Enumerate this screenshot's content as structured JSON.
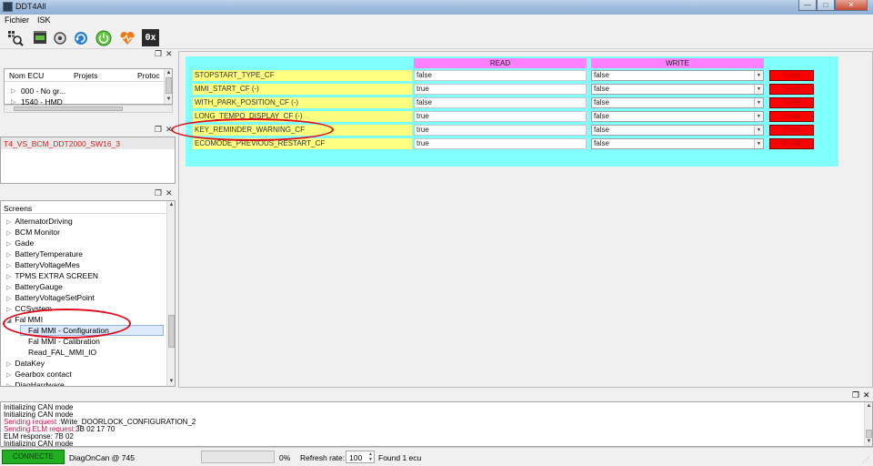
{
  "window": {
    "title": "DDT4All",
    "min_glyph": "—",
    "max_glyph": "□",
    "close_glyph": "✕"
  },
  "menu": {
    "items": [
      "Fichier",
      "ISK"
    ]
  },
  "toolbar": {
    "last_label": "0x"
  },
  "ecu_dock": {
    "columns": [
      "Nom ECU",
      "Projets",
      "Protoc"
    ],
    "rows": [
      "000 - No gr...",
      "1540 - HMD"
    ]
  },
  "project_dock": {
    "item": "T4_VS_BCM_DDT2000_SW16_3"
  },
  "screens_dock": {
    "header": "Screens",
    "items": [
      {
        "label": "AlternatorDriving",
        "arrow": "▷",
        "indent": 0
      },
      {
        "label": "BCM Monitor",
        "arrow": "▷",
        "indent": 0
      },
      {
        "label": "Gade",
        "arrow": "▷",
        "indent": 0
      },
      {
        "label": "BatteryTemperature",
        "arrow": "▷",
        "indent": 0
      },
      {
        "label": "BatteryVoltageMes",
        "arrow": "▷",
        "indent": 0
      },
      {
        "label": "TPMS EXTRA SCREEN",
        "arrow": "▷",
        "indent": 0
      },
      {
        "label": "BatteryGauge",
        "arrow": "▷",
        "indent": 0
      },
      {
        "label": "BatteryVoltageSetPoint",
        "arrow": "▷",
        "indent": 0
      },
      {
        "label": "CCSystem",
        "arrow": "▷",
        "indent": 0
      },
      {
        "label": "Fal MMI",
        "arrow": "◢",
        "indent": 0
      },
      {
        "label": "Fal MMI - Configuration",
        "arrow": "",
        "indent": 1,
        "selected": true
      },
      {
        "label": "Fal MMI - Calibration",
        "arrow": "",
        "indent": 1
      },
      {
        "label": "Read_FAL_MMI_IO",
        "arrow": "",
        "indent": 1
      },
      {
        "label": "DataKey",
        "arrow": "▷",
        "indent": 0
      },
      {
        "label": "Gearbox contact",
        "arrow": "▷",
        "indent": 0
      },
      {
        "label": "DiagHardware",
        "arrow": "▷",
        "indent": 0
      }
    ]
  },
  "config_panel": {
    "read_header": "READ",
    "write_header": "WRITE",
    "send_label": "Send",
    "rows": [
      {
        "name": "STOPSTART_TYPE_CF",
        "read": "false",
        "write": "false"
      },
      {
        "name": "MMI_START_CF (-)",
        "read": "true",
        "write": "false"
      },
      {
        "name": "WITH_PARK_POSITION_CF (-)",
        "read": "false",
        "write": "false"
      },
      {
        "name": "LONG_TEMPO_DISPLAY_CF (-)",
        "read": "true",
        "write": "false"
      },
      {
        "name": "KEY_REMINDER_WARNING_CF",
        "read": "true",
        "write": "false"
      },
      {
        "name": "ECOMODE_PREVIOUS_RESTART_CF",
        "read": "true",
        "write": "false"
      }
    ]
  },
  "log": {
    "lines": [
      {
        "text": "Initializing CAN mode",
        "color": "#000000"
      },
      {
        "text": "Initializing CAN mode",
        "color": "#000000"
      },
      {
        "prefix": "Sending request :",
        "rest": "Write_DOORLOCK_CONFIGURATION_2",
        "color": "#c0184a"
      },
      {
        "prefix": "Sending ELM request:",
        "rest": "3B 02 17 70",
        "color": "#c0184a"
      },
      {
        "text": "ELM response: 7B 02",
        "color": "#000000"
      },
      {
        "text": "Initializing CAN mode",
        "color": "#000000"
      }
    ]
  },
  "status": {
    "connected": "CONNECTE",
    "protocol": "DiagOnCan @ 745",
    "progress_percent": 0,
    "progress_label": "0%",
    "refresh_label": "Refresh rate:",
    "refresh_value": "100",
    "found": "Found 1 ecu"
  },
  "colors": {
    "connected_bg": "#22b022",
    "panel_bg": "#80ffff",
    "header_bg": "#ff80ff",
    "label_bg": "#ffff80",
    "send_bg": "#ff0000",
    "annotation": "#e0081a"
  }
}
